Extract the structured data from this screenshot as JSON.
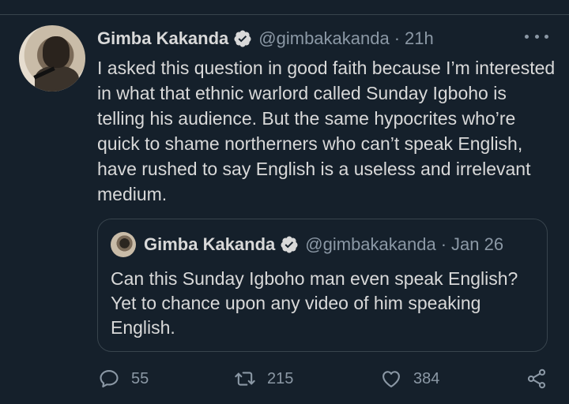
{
  "tweet": {
    "author_name": "Gimba Kakanda",
    "handle": "@gimbakakanda",
    "separator": "·",
    "time": "21h",
    "text": "I asked this question in good faith because I’m interested in what that ethnic warlord called Sunday Igboho is telling his audience. But the same hypocrites who’re quick to shame northerners who can’t speak English, have rushed to say English is a useless and irrelevant medium."
  },
  "quoted_tweet": {
    "author_name": "Gimba Kakanda",
    "handle": "@gimbakakanda",
    "separator": "·",
    "time": "Jan 26",
    "text": "Can this Sunday Igboho man even speak English? Yet to chance upon any video of him speaking English."
  },
  "actions": {
    "reply_count": "55",
    "retweet_count": "215",
    "like_count": "384"
  },
  "icons": {
    "verified": "verified-badge-icon",
    "more": "more-options-icon",
    "reply": "reply-icon",
    "retweet": "retweet-icon",
    "like": "heart-icon",
    "share": "share-icon"
  },
  "colors": {
    "background": "#15202b",
    "text": "#d9d9d9",
    "secondary_text": "#8b98a5",
    "border": "#38444d"
  }
}
